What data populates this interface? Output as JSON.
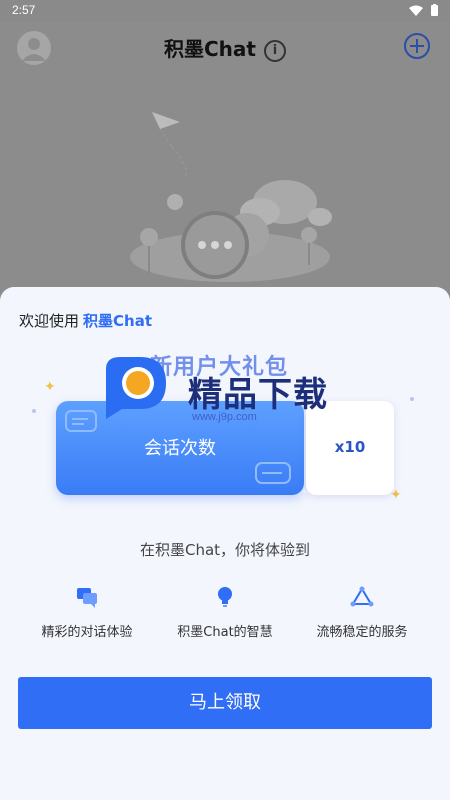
{
  "status_bar": {
    "time": "2:57"
  },
  "app_bar": {
    "title": "积墨Chat",
    "info_icon_glyph": "i"
  },
  "sheet": {
    "greeting": "欢迎使用",
    "brand": "积墨Chat",
    "gift_title": "新用户大礼包",
    "ticket_label": "会话次数",
    "ticket_count": "x10",
    "subtitle": "在积墨Chat，你将体验到",
    "features": [
      {
        "icon": "chat-bubbles-icon",
        "label": "精彩的对话体验"
      },
      {
        "icon": "lightbulb-icon",
        "label": "积墨Chat的智慧"
      },
      {
        "icon": "triangle-nodes-icon",
        "label": "流畅稳定的服务"
      }
    ],
    "cta_label": "马上领取"
  },
  "watermark": {
    "text": "精品下载",
    "sub": "www.j9p.com"
  },
  "colors": {
    "accent": "#2f6ef5",
    "sheet_bg": "#f3f6fd",
    "dim_bg": "#8c8c8c"
  }
}
